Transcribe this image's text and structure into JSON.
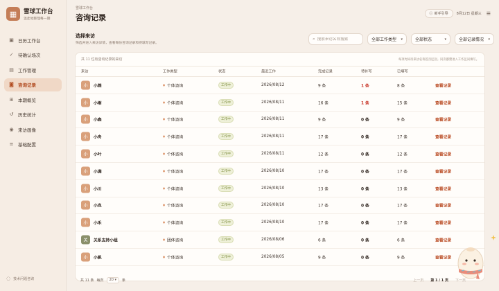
{
  "brand": {
    "logo_icon": "book-icon",
    "title": "雪球工作台",
    "subtitle": "温柔地整理每一期"
  },
  "sidebar": {
    "items": [
      {
        "label": "日历工作台",
        "icon": "calendar-icon",
        "glyph": "▣",
        "active": false
      },
      {
        "label": "待确认场次",
        "icon": "check-circle-icon",
        "glyph": "✓",
        "active": false
      },
      {
        "label": "工作管理",
        "icon": "folder-icon",
        "glyph": "▤",
        "active": false
      },
      {
        "label": "咨询记录",
        "icon": "user-card-icon",
        "glyph": "◙",
        "active": true
      },
      {
        "label": "本期概览",
        "icon": "grid-icon",
        "glyph": "⊞",
        "active": false
      },
      {
        "label": "历史统计",
        "icon": "history-icon",
        "glyph": "↺",
        "active": false
      },
      {
        "label": "来访画像",
        "icon": "user-icon",
        "glyph": "◉",
        "active": false
      },
      {
        "label": "基础配置",
        "icon": "sliders-icon",
        "glyph": "≡",
        "active": false
      }
    ],
    "footer": {
      "icon": "chat-icon",
      "label": "技术问题咨询"
    }
  },
  "header": {
    "breadcrumb": "雪球工作台",
    "title": "咨询记录",
    "guide_label": "新手引导",
    "date_text": "8月12日 星期三"
  },
  "filters": {
    "title": "选择来访",
    "subtitle": "筛选并进入来访详情，查看每份咨询记录和待填写记录。",
    "search_placeholder": "搜索来访名称搜索",
    "type_select": "全部工作类型",
    "status_select": "全部状态",
    "record_select": "全部记录情况"
  },
  "table": {
    "count_text": "共 11 位有咨询记录的来访",
    "hint_text": "每项时间待来访名称首页区别，同次都需进入工作区间填写。",
    "columns": [
      "来访",
      "工作类型",
      "状态",
      "最近工作",
      "完成记录",
      "待补写",
      "已填写"
    ],
    "action_label": "查看记录",
    "rows": [
      {
        "avatar": "小",
        "name": "小燕",
        "type": "个体咨询",
        "status": "工作中",
        "date": "2026/08/12",
        "done": "9 条",
        "todo": "1 条",
        "todo_flag": true,
        "filled": "8 条",
        "group": false
      },
      {
        "avatar": "小",
        "name": "小雨",
        "type": "个体咨询",
        "status": "工作中",
        "date": "2026/08/11",
        "done": "16 条",
        "todo": "1 条",
        "todo_flag": true,
        "filled": "15 条",
        "group": false
      },
      {
        "avatar": "小",
        "name": "小森",
        "type": "个体咨询",
        "status": "工作中",
        "date": "2026/08/11",
        "done": "9 条",
        "todo": "0 条",
        "todo_flag": false,
        "filled": "9 条",
        "group": false
      },
      {
        "avatar": "小",
        "name": "小舟",
        "type": "个体咨询",
        "status": "工作中",
        "date": "2026/08/11",
        "done": "17 条",
        "todo": "0 条",
        "todo_flag": false,
        "filled": "17 条",
        "group": false
      },
      {
        "avatar": "小",
        "name": "小叶",
        "type": "个体咨询",
        "status": "工作中",
        "date": "2026/08/11",
        "done": "12 条",
        "todo": "0 条",
        "todo_flag": false,
        "filled": "12 条",
        "group": false
      },
      {
        "avatar": "小",
        "name": "小满",
        "type": "个体咨询",
        "status": "工作中",
        "date": "2026/08/10",
        "done": "17 条",
        "todo": "0 条",
        "todo_flag": false,
        "filled": "17 条",
        "group": false
      },
      {
        "avatar": "小",
        "name": "小川",
        "type": "个体咨询",
        "status": "工作中",
        "date": "2026/08/10",
        "done": "13 条",
        "todo": "0 条",
        "todo_flag": false,
        "filled": "13 条",
        "group": false
      },
      {
        "avatar": "小",
        "name": "小岚",
        "type": "个体咨询",
        "status": "工作中",
        "date": "2026/08/10",
        "done": "17 条",
        "todo": "0 条",
        "todo_flag": false,
        "filled": "17 条",
        "group": false
      },
      {
        "avatar": "小",
        "name": "小禾",
        "type": "个体咨询",
        "status": "工作中",
        "date": "2026/08/10",
        "done": "17 条",
        "todo": "0 条",
        "todo_flag": false,
        "filled": "17 条",
        "group": false
      },
      {
        "avatar": "关",
        "name": "关系支持小组",
        "type": "团体咨询",
        "status": "工作中",
        "date": "2026/08/06",
        "done": "6 条",
        "todo": "0 条",
        "todo_flag": false,
        "filled": "6 条",
        "group": true
      },
      {
        "avatar": "小",
        "name": "小帆",
        "type": "个体咨询",
        "status": "工作中",
        "date": "2026/08/05",
        "done": "9 条",
        "todo": "0 条",
        "todo_flag": false,
        "filled": "9 条",
        "group": false
      }
    ]
  },
  "pager": {
    "total": "共 11 条",
    "per_page_label": "每页",
    "per_page_value": "20",
    "per_page_unit": "条",
    "prev": "上一页",
    "page_info": "第 1 / 1 页",
    "next": "下一页"
  },
  "colors": {
    "accent": "#b24d22",
    "avatar": "#d9a07a",
    "todo_alert": "#c8372a",
    "badge_text": "#7a8a3a"
  }
}
